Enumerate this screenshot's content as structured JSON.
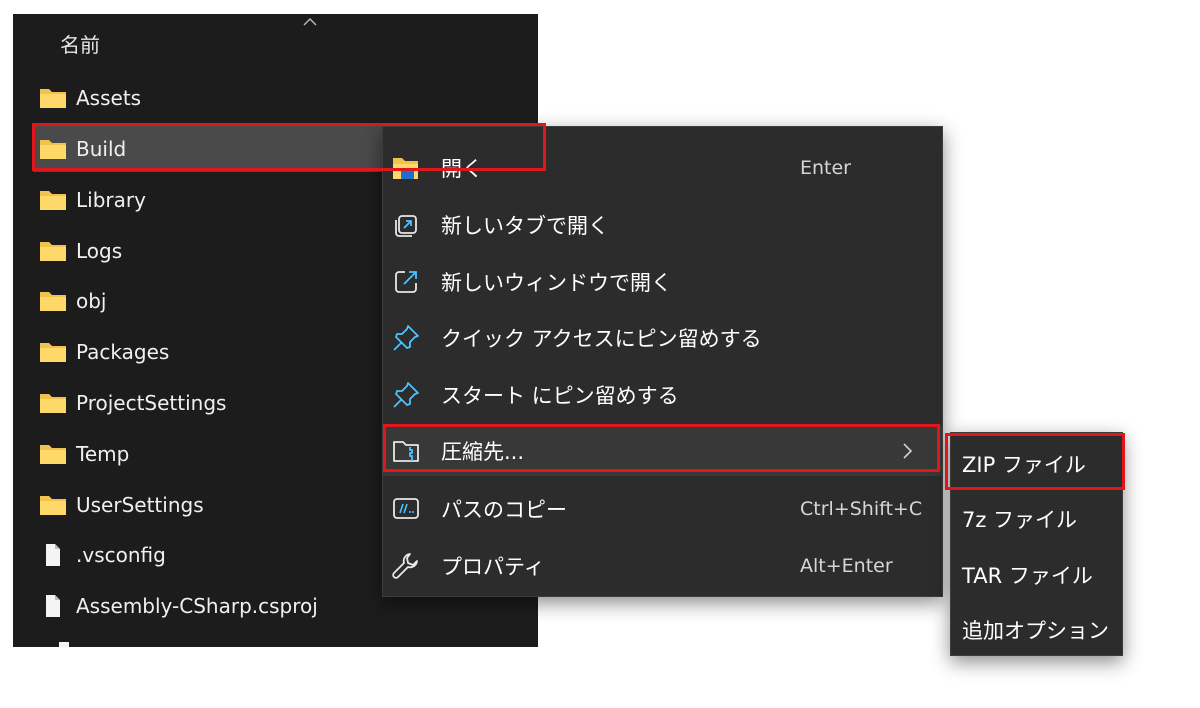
{
  "explorer": {
    "column_header": "名前",
    "items": [
      {
        "name": "Assets",
        "type": "folder"
      },
      {
        "name": "Build",
        "type": "folder",
        "selected": true
      },
      {
        "name": "Library",
        "type": "folder"
      },
      {
        "name": "Logs",
        "type": "folder"
      },
      {
        "name": "obj",
        "type": "folder"
      },
      {
        "name": "Packages",
        "type": "folder"
      },
      {
        "name": "ProjectSettings",
        "type": "folder"
      },
      {
        "name": "Temp",
        "type": "folder"
      },
      {
        "name": "UserSettings",
        "type": "folder"
      },
      {
        "name": ".vsconfig",
        "type": "file"
      },
      {
        "name": "Assembly-CSharp.csproj",
        "type": "file"
      }
    ]
  },
  "context_menu": {
    "items": [
      {
        "label": "開く",
        "shortcut": "Enter",
        "icon": "folder-open-icon"
      },
      {
        "label": "新しいタブで開く",
        "shortcut": "",
        "icon": "new-tab-icon"
      },
      {
        "label": "新しいウィンドウで開く",
        "shortcut": "",
        "icon": "new-window-icon"
      },
      {
        "label": "クイック アクセスにピン留めする",
        "shortcut": "",
        "icon": "pin-icon"
      },
      {
        "label": "スタート にピン留めする",
        "shortcut": "",
        "icon": "pin-icon"
      },
      {
        "label": "圧縮先...",
        "shortcut": "",
        "icon": "zip-folder-icon",
        "has_submenu": true
      },
      {
        "label": "パスのコピー",
        "shortcut": "Ctrl+Shift+C",
        "icon": "copy-path-icon"
      },
      {
        "label": "プロパティ",
        "shortcut": "Alt+Enter",
        "icon": "wrench-icon"
      }
    ]
  },
  "submenu": {
    "items": [
      "ZIP ファイル",
      "7z ファイル",
      "TAR ファイル",
      "追加オプション"
    ]
  },
  "colors": {
    "folder": "#f2c14e",
    "accent_blue": "#4cc2ff",
    "highlight_red": "#e0161b"
  }
}
